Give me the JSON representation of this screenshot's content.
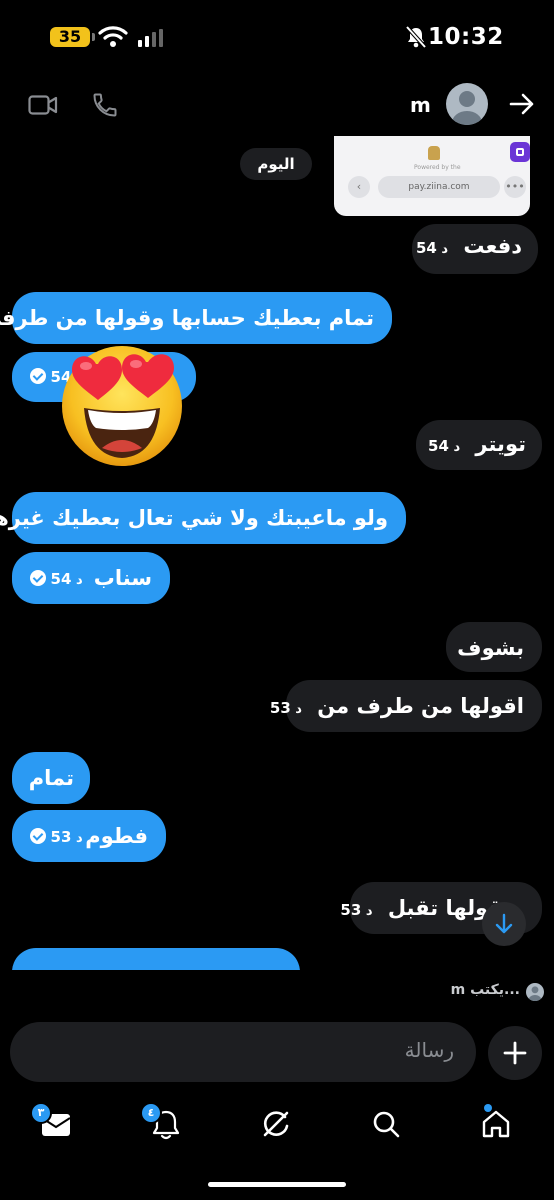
{
  "status_bar": {
    "battery": "35",
    "time": "10:32"
  },
  "header": {
    "contact_name": "m"
  },
  "chat": {
    "day_label": "اليوم",
    "screenshot_url": "pay.ziina.com",
    "screenshot_caption": "Powered by the",
    "messages": [
      {
        "text": "دفعت",
        "time": "54",
        "unit": "د"
      },
      {
        "text": "تمام بعطيك حسابها وقولها من طرفي"
      },
      {
        "text": "",
        "time": "54",
        "unit": "د"
      },
      {
        "text": "تويتر",
        "time": "54",
        "unit": "د"
      },
      {
        "text": "ولو ماعيبتك ولا شي تعال بعطيك غيرها"
      },
      {
        "text": "سناب",
        "time": "54",
        "unit": "د"
      },
      {
        "text": "بشوف"
      },
      {
        "text": "اقولها من طرف من",
        "time": "53",
        "unit": "د"
      },
      {
        "text": "تمام"
      },
      {
        "text": "فطوم",
        "time": "53",
        "unit": "د"
      },
      {
        "text": "قولها تقبل",
        "time": "53",
        "unit": "د"
      }
    ]
  },
  "typing": {
    "text": "...يكتب",
    "name": "m"
  },
  "composer": {
    "placeholder": "رسالة"
  },
  "tabs": {
    "messages_count": "٣",
    "notifications_count": "٤"
  }
}
